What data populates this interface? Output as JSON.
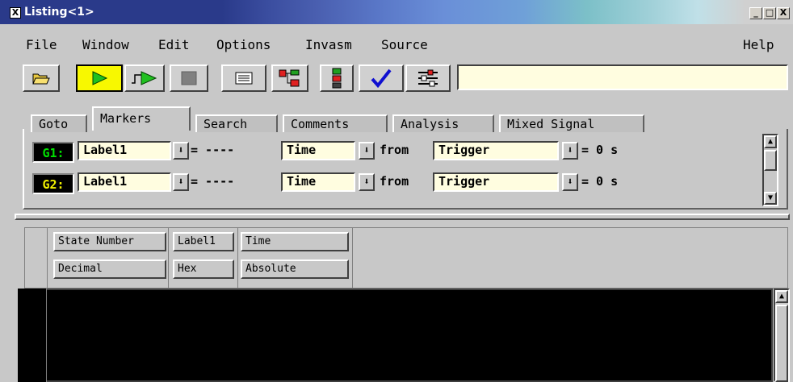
{
  "window": {
    "title": "Listing<1>",
    "icon_text": "X",
    "controls": {
      "minimize": "_",
      "maximize": "□",
      "close": "X"
    }
  },
  "menu": {
    "items": [
      "File",
      "Window",
      "Edit",
      "Options",
      "Invasm",
      "Source"
    ],
    "help": "Help"
  },
  "toolbar": {
    "buttons": [
      "open-folder-icon",
      "run-single-icon",
      "run-repetitive-icon",
      "stop-icon",
      "listing-icon",
      "hierarchy-icon",
      "module-icon",
      "checkmark-icon",
      "settings-icon"
    ],
    "input_value": ""
  },
  "tabs": {
    "items": [
      "Goto",
      "Markers",
      "Search",
      "Comments",
      "Analysis",
      "Mixed Signal"
    ],
    "active": "Markers"
  },
  "markers": [
    {
      "name": "G1:",
      "color": "#00e000",
      "label": "Label1",
      "equals": "= ----",
      "mode": "Time",
      "from_text": "from",
      "reference": "Trigger",
      "result": "= 0 s"
    },
    {
      "name": "G2:",
      "color": "#f0f000",
      "label": "Label1",
      "equals": "= ----",
      "mode": "Time",
      "from_text": "from",
      "reference": "Trigger",
      "result": "= 0 s"
    }
  ],
  "listing": {
    "columns": [
      {
        "title": "State Number",
        "base": "Decimal"
      },
      {
        "title": "Label1",
        "base": "Hex"
      },
      {
        "title": "Time",
        "base": "Absolute"
      }
    ]
  },
  "colors": {
    "field_bg": "#fffde0",
    "listing_bg": "#000000",
    "panel_bg": "#c8c8c8"
  }
}
